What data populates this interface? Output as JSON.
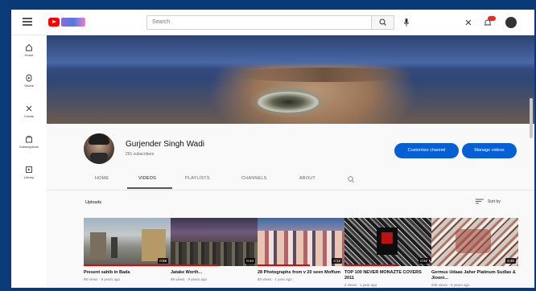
{
  "header": {
    "search_placeholder": "Search"
  },
  "rail": {
    "items": [
      {
        "label": "Home"
      },
      {
        "label": "Shorts"
      },
      {
        "label": "Create"
      },
      {
        "label": "Subscriptions"
      },
      {
        "label": "Library"
      }
    ]
  },
  "channel": {
    "name": "Gurjender Singh Wadi",
    "subscribers": "291 subscribers",
    "customize_label": "Customize channel",
    "manage_label": "Manage videos",
    "tabs": [
      "HOME",
      "VIDEOS",
      "PLAYLISTS",
      "CHANNELS",
      "ABOUT"
    ],
    "active_tab": "VIDEOS"
  },
  "uploads": {
    "heading": "Uploads",
    "sort_label": "Sort by",
    "videos": [
      {
        "title": "Present sahib in Bada",
        "meta": "88 views · 9 years ago",
        "duration": "0:58",
        "progress": 1.0
      },
      {
        "title": "Jatake Worth...",
        "meta": "99 views · 9 years ago",
        "duration": "0:34",
        "progress": 0.55
      },
      {
        "title": "28 Photographs from v 20 seen Moffum",
        "meta": "80 views · 1 year ago",
        "duration": "2:12",
        "progress": 0.6
      },
      {
        "title": "TOP 100 NEVER MONAZTE COVERS 2011",
        "meta": "2 views · 1 year ago",
        "duration": "0:22",
        "progress": 0.6
      },
      {
        "title": "Germus Udaas Jaher Platinum Sudlas & Jiooni...",
        "meta": "846 views · 9 years ago",
        "duration": "5:36",
        "progress": 0
      }
    ]
  },
  "colors": {
    "accent": "#065fd4",
    "logo_red": "#ff0000",
    "progress_red": "#e00000",
    "frame_border": "#0b3a78"
  }
}
